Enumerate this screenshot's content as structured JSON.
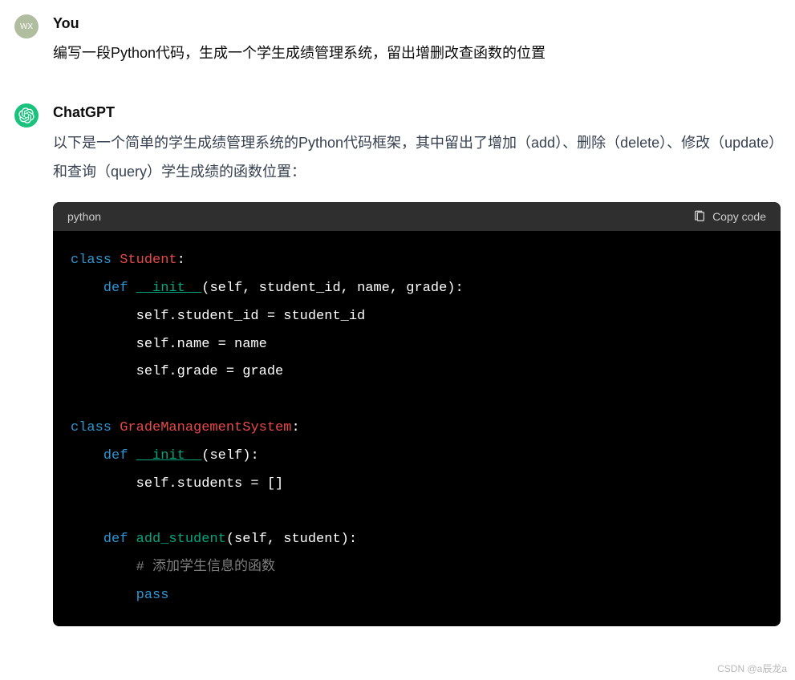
{
  "user": {
    "avatar_text": "WX",
    "author": "You",
    "message": "编写一段Python代码，生成一个学生成绩管理系统，留出增删改查函数的位置"
  },
  "assistant": {
    "author": "ChatGPT",
    "message": "以下是一个简单的学生成绩管理系统的Python代码框架，其中留出了增加（add）、删除（delete）、修改（update）和查询（query）学生成绩的函数位置："
  },
  "code": {
    "language": "python",
    "copy_label": "Copy code",
    "tokens": {
      "class_kw": "class",
      "def_kw": "def",
      "pass_kw": "pass",
      "student_cls": "Student",
      "gms_cls": "GradeManagementSystem",
      "init_fn": "__init__",
      "add_fn": "add_student",
      "init_params1": "(self, student_id, name, grade):",
      "init_params2": "(self):",
      "add_params": "(self, student):",
      "line_sid": "        self.student_id = student_id",
      "line_name": "        self.name = name",
      "line_grade": "        self.grade = grade",
      "line_students": "        self.students = []",
      "comment_add": "        # 添加学生信息的函数",
      "colon": ":"
    }
  },
  "watermark": "CSDN @a辰龙a"
}
